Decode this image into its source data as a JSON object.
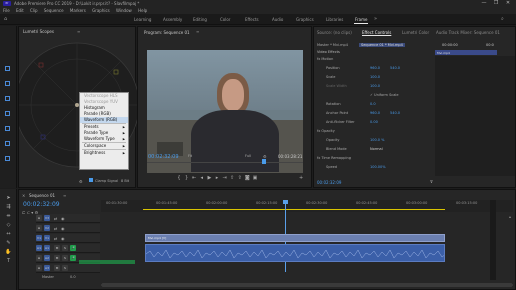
{
  "app": {
    "title": "Adobe Premiere Pro CC 2019 - D:\\Lokit ir.prpr.it? - Slavfilmpaj *",
    "win_controls": [
      "—",
      "❐",
      "✕"
    ]
  },
  "menu": [
    "File",
    "Edit",
    "Clip",
    "Sequence",
    "Markers",
    "Graphics",
    "Window",
    "Help"
  ],
  "workspaces": [
    {
      "label": "Learning",
      "active": false
    },
    {
      "label": "Assembly",
      "active": false
    },
    {
      "label": "Editing",
      "active": false
    },
    {
      "label": "Color",
      "active": false
    },
    {
      "label": "Effects",
      "active": false
    },
    {
      "label": "Audio",
      "active": false
    },
    {
      "label": "Graphics",
      "active": false
    },
    {
      "label": "Libraries",
      "active": false
    },
    {
      "label": "Frame",
      "active": true
    }
  ],
  "scopes": {
    "tab": "Lumetri Scopes",
    "bottom": {
      "clamp": "Clamp Signal",
      "bit": "8 Bit"
    }
  },
  "scope_menu": {
    "items": [
      {
        "label": "Vectorscope HLS",
        "enabled": false
      },
      {
        "label": "Vectorscope YUV",
        "enabled": false
      },
      {
        "label": "Histogram",
        "enabled": true
      },
      {
        "label": "Parade (RGB)",
        "enabled": true
      },
      {
        "label": "Waveform (RGB)",
        "enabled": true,
        "highlight": true
      },
      {
        "sep": true
      },
      {
        "label": "Presets",
        "enabled": true,
        "sub": true
      },
      {
        "label": "Parade Type",
        "enabled": true,
        "sub": true
      },
      {
        "label": "Waveform Type",
        "enabled": true,
        "sub": true
      },
      {
        "sep": true
      },
      {
        "label": "Colorspace",
        "enabled": true,
        "sub": true
      },
      {
        "sep": true
      },
      {
        "label": "Brightness",
        "enabled": true,
        "sub": true
      }
    ]
  },
  "program": {
    "tab": "Program: Sequence 01",
    "timecode": "00:02:32:09",
    "fit": "Fit",
    "quality": "Full",
    "duration": "00:03:28:21"
  },
  "effects": {
    "tabs": [
      "Source: (no clips)",
      "Effect Controls",
      "Lumetri Color",
      "Audio Track Mixer: Sequence 01"
    ],
    "master": "Master * Mvi.mp4",
    "seq": "Sequence 01 * Mvi.mp4",
    "mini_time": "00:00:00",
    "mini_time2": "00:0",
    "clip_label": "Mvi.mp4",
    "section": "Video Effects",
    "rows": [
      {
        "label": "fx  Motion",
        "value": "",
        "indent": 1
      },
      {
        "label": "Position",
        "value": "960.0",
        "value2": "540.0",
        "indent": 2
      },
      {
        "label": "Scale",
        "value": "100.0",
        "indent": 2
      },
      {
        "label": "Scale Width",
        "value": "100.0",
        "indent": 2,
        "dim": true
      },
      {
        "label": "",
        "value": "✓ Uniform Scale",
        "indent": 2
      },
      {
        "label": "Rotation",
        "value": "0.0",
        "indent": 2
      },
      {
        "label": "Anchor Point",
        "value": "960.0",
        "value2": "540.0",
        "indent": 2
      },
      {
        "label": "Anti-flicker Filter",
        "value": "0.00",
        "indent": 2
      },
      {
        "label": "fx  Opacity",
        "value": "",
        "indent": 1
      },
      {
        "label": "Opacity",
        "value": "100.0 %",
        "indent": 2
      },
      {
        "label": "Blend Mode",
        "value": "Normal",
        "indent": 2
      },
      {
        "label": "fx  Time Remapping",
        "value": "",
        "indent": 1
      },
      {
        "label": "Speed",
        "value": "100.00%",
        "indent": 2
      }
    ],
    "footer_time": "00:02:32:09"
  },
  "timeline": {
    "tab": "Sequence 01",
    "timecode": "00:02:32:09",
    "ruler": [
      "00:01:30:00",
      "00:01:45:00",
      "00:02:00:00",
      "00:02:15:00",
      "00:02:30:00",
      "00:02:45:00",
      "00:03:00:00",
      "00:03:15:00"
    ],
    "tracks": [
      {
        "id": "V3",
        "type": "video"
      },
      {
        "id": "V2",
        "type": "video"
      },
      {
        "id": "V1",
        "type": "video",
        "clip": "Mvi.mp4 [V]"
      },
      {
        "id": "A1",
        "type": "audio"
      },
      {
        "id": "A2",
        "type": "audio"
      },
      {
        "id": "A3",
        "type": "audio"
      }
    ],
    "master": {
      "label": "Master",
      "value": "0.0"
    },
    "zoom_label": "◯"
  },
  "colors": {
    "accent": "#4a9bea",
    "playhead": "#5aa0ea",
    "clip_v": "#6b7fb0",
    "clip_a": "#3b5fa8",
    "yellow": "#d9c400"
  }
}
